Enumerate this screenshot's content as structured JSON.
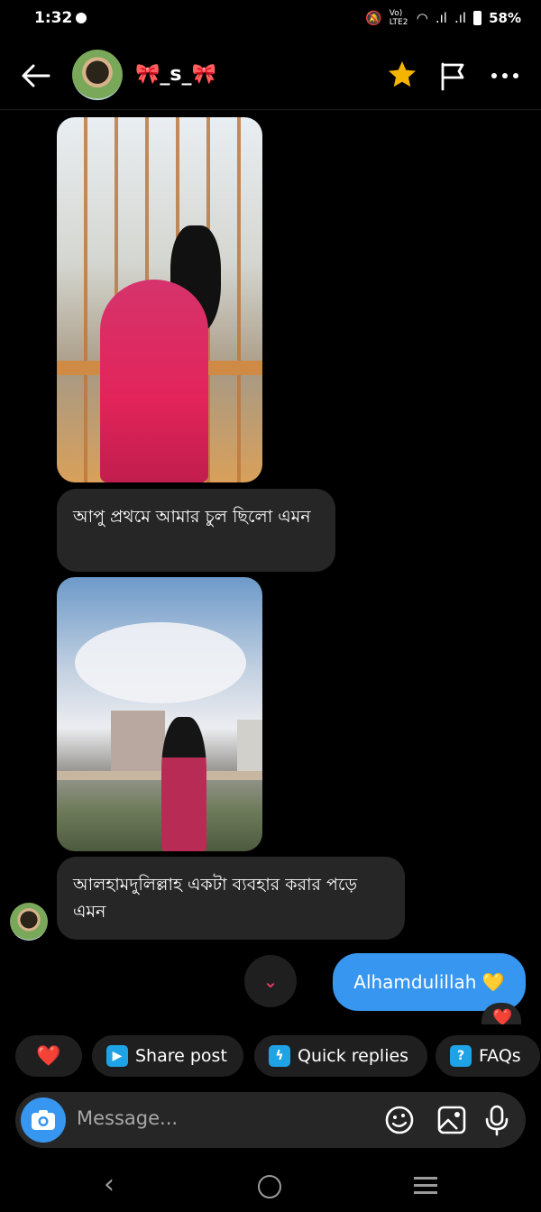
{
  "status_bar": {
    "time": "1:32",
    "battery": "58%",
    "network_label": "Vo) LTE2"
  },
  "header": {
    "contact_name": "🎀_s_🎀",
    "icons": [
      "back-arrow-icon",
      "star-icon",
      "flag-icon",
      "more-icon"
    ],
    "star_color": "#f5b400"
  },
  "messages": [
    {
      "type": "image",
      "sender": "them",
      "description_icon": "photo"
    },
    {
      "type": "text",
      "sender": "them",
      "text": "আপু প্রথমে আমার চুল ছিলো এমন"
    },
    {
      "type": "image",
      "sender": "them",
      "description_icon": "photo"
    },
    {
      "type": "text",
      "sender": "them",
      "text": "আলহামদুলিল্লাহ একটা ব্যবহার করার পড়ে এমন"
    },
    {
      "type": "text",
      "sender": "me",
      "text": "Alhamdulillah 💛",
      "reaction": "❤️"
    }
  ],
  "quick_actions": {
    "heart": "❤️",
    "share_post": "Share post",
    "quick_replies": "Quick replies",
    "faqs": "FAQs"
  },
  "composer": {
    "placeholder": "Message..."
  },
  "colors": {
    "accent": "#3797f0",
    "bubble_incoming": "#262626",
    "chip_icon": "#1ea4e6"
  }
}
